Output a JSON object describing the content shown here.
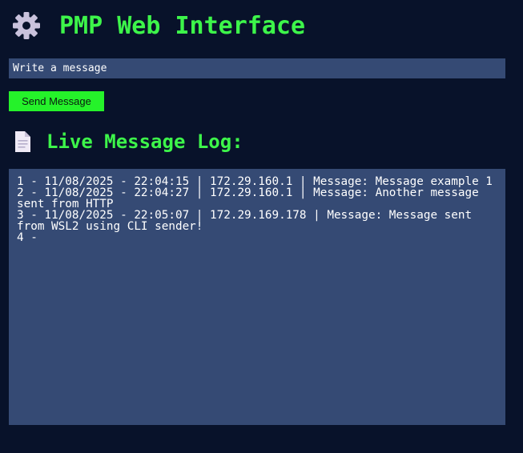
{
  "header": {
    "title": "PMP Web Interface",
    "icon": "gear-icon"
  },
  "compose": {
    "input_value": "",
    "input_placeholder": "Write a message",
    "send_label": "Send Message"
  },
  "log": {
    "title": "Live Message Log:",
    "icon": "document-icon",
    "entries": [
      "1 - 11/08/2025 - 22:04:15 | 172.29.160.1 | Message: Message example 1",
      "2 - 11/08/2025 - 22:04:27 | 172.29.160.1 | Message: Another message sent from HTTP",
      "3 - 11/08/2025 - 22:05:07 | 172.29.169.178 | Message: Message sent from WSL2 using CLI sender!",
      "4 -"
    ]
  },
  "colors": {
    "page_background": "#08122a",
    "panel_background": "#354a74",
    "accent_green": "#3df54a",
    "button_green": "#25f22a",
    "text": "#ffffff"
  }
}
